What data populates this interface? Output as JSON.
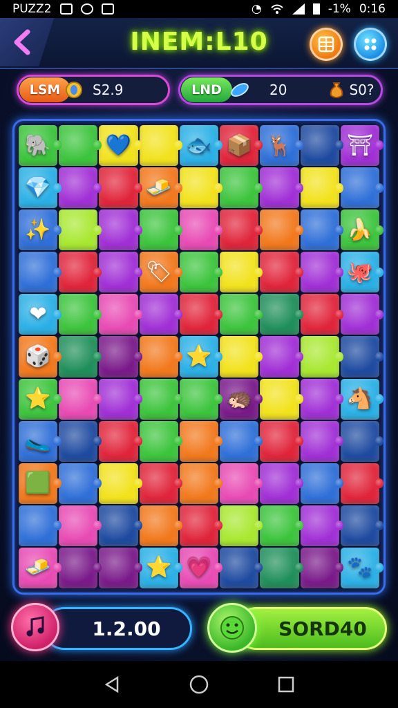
{
  "status_bar": {
    "app_label": "PUZZ2",
    "battery_text": "-1%",
    "time": "0:16"
  },
  "header": {
    "title": "INEM:L10",
    "back_icon": "back-arrow-icon",
    "grid_icon": "grid-icon",
    "menu_icon": "dots-menu-icon"
  },
  "stats": {
    "left_label": "LSM",
    "left_icon": "coin-icon",
    "left_value": "S2.9",
    "right_label": "LND",
    "right_icon": "gem-icon",
    "right_value": "20",
    "right_icon2": "pouch-icon",
    "right_value2": "S0?"
  },
  "board": {
    "columns": 9,
    "rows": 11,
    "colors": {
      "G": "#3cc43c",
      "Y": "#f2e21c",
      "R": "#e0243a",
      "P": "#a12fd6",
      "B": "#2f6fd8",
      "O": "#f2781c",
      "K": "#e84ab4",
      "C": "#2ab0e6",
      "L": "#a8e830",
      "M": "#7a1a8a",
      "D": "#1e4aa0",
      "N": "#1f8f5a"
    },
    "tiles": [
      [
        "G",
        "G",
        "Y",
        "Y",
        "C",
        "R",
        "B",
        "D",
        "P"
      ],
      [
        "C",
        "P",
        "R",
        "O",
        "Y",
        "G",
        "P",
        "Y",
        "B"
      ],
      [
        "B",
        "L",
        "P",
        "G",
        "K",
        "R",
        "O",
        "B",
        "G"
      ],
      [
        "B",
        "R",
        "P",
        "O",
        "G",
        "Y",
        "R",
        "P",
        "C"
      ],
      [
        "C",
        "G",
        "K",
        "P",
        "R",
        "G",
        "N",
        "R",
        "P"
      ],
      [
        "O",
        "N",
        "M",
        "O",
        "C",
        "Y",
        "P",
        "L",
        "D"
      ],
      [
        "G",
        "K",
        "P",
        "G",
        "G",
        "M",
        "Y",
        "P",
        "C"
      ],
      [
        "B",
        "D",
        "R",
        "G",
        "O",
        "B",
        "R",
        "P",
        "D"
      ],
      [
        "O",
        "B",
        "Y",
        "R",
        "O",
        "K",
        "P",
        "B",
        "R"
      ],
      [
        "B",
        "K",
        "D",
        "O",
        "R",
        "L",
        "G",
        "P",
        "D"
      ],
      [
        "K",
        "M",
        "M",
        "C",
        "K",
        "D",
        "N",
        "M",
        "C"
      ]
    ],
    "pieces": [
      {
        "r": 0,
        "c": 0,
        "glyph": "🐘",
        "name": "elephant-piece-icon"
      },
      {
        "r": 0,
        "c": 2,
        "glyph": "💙",
        "name": "heart-piece-icon"
      },
      {
        "r": 0,
        "c": 4,
        "glyph": "🐟",
        "name": "fish-piece-icon"
      },
      {
        "r": 0,
        "c": 5,
        "glyph": "📦",
        "name": "box-piece-icon"
      },
      {
        "r": 0,
        "c": 6,
        "glyph": "🦌",
        "name": "deer-piece-icon"
      },
      {
        "r": 0,
        "c": 8,
        "glyph": "⛩",
        "name": "gate-piece-icon"
      },
      {
        "r": 1,
        "c": 0,
        "glyph": "💎",
        "name": "gem-piece-icon"
      },
      {
        "r": 1,
        "c": 3,
        "glyph": "🧈",
        "name": "gold-bar-piece-icon"
      },
      {
        "r": 2,
        "c": 0,
        "glyph": "✨",
        "name": "sparkle-piece-icon"
      },
      {
        "r": 2,
        "c": 8,
        "glyph": "🍌",
        "name": "banana-piece-icon"
      },
      {
        "r": 3,
        "c": 3,
        "glyph": "🏷",
        "name": "tag-piece-icon"
      },
      {
        "r": 3,
        "c": 8,
        "glyph": "🐙",
        "name": "octopus-piece-icon"
      },
      {
        "r": 4,
        "c": 0,
        "glyph": "❤",
        "name": "heart-red-piece-icon"
      },
      {
        "r": 5,
        "c": 0,
        "glyph": "🎲",
        "name": "dice-piece-icon"
      },
      {
        "r": 5,
        "c": 4,
        "glyph": "⭐",
        "name": "star-piece-icon"
      },
      {
        "r": 6,
        "c": 0,
        "glyph": "⭐",
        "name": "starfish-piece-icon"
      },
      {
        "r": 6,
        "c": 5,
        "glyph": "🦔",
        "name": "hedgehog-piece-icon"
      },
      {
        "r": 6,
        "c": 8,
        "glyph": "🐴",
        "name": "horse-piece-icon"
      },
      {
        "r": 7,
        "c": 0,
        "glyph": "🥿",
        "name": "shoe-piece-icon"
      },
      {
        "r": 8,
        "c": 0,
        "glyph": "🟩",
        "name": "frame-piece-icon"
      },
      {
        "r": 10,
        "c": 0,
        "glyph": "🧈",
        "name": "gold-bar-piece-icon"
      },
      {
        "r": 10,
        "c": 3,
        "glyph": "⭐",
        "name": "star-piece-icon"
      },
      {
        "r": 10,
        "c": 4,
        "glyph": "💗",
        "name": "shield-piece-icon"
      },
      {
        "r": 10,
        "c": 8,
        "glyph": "🐾",
        "name": "creature-piece-icon"
      }
    ]
  },
  "bottom": {
    "music_icon": "music-note-icon",
    "score": "1.2.00",
    "smile_icon": "smile-face-icon",
    "bonus": "SORD40"
  },
  "navbar": {
    "back_icon": "nav-back-icon",
    "home_icon": "nav-home-icon",
    "recents_icon": "nav-recents-icon"
  }
}
